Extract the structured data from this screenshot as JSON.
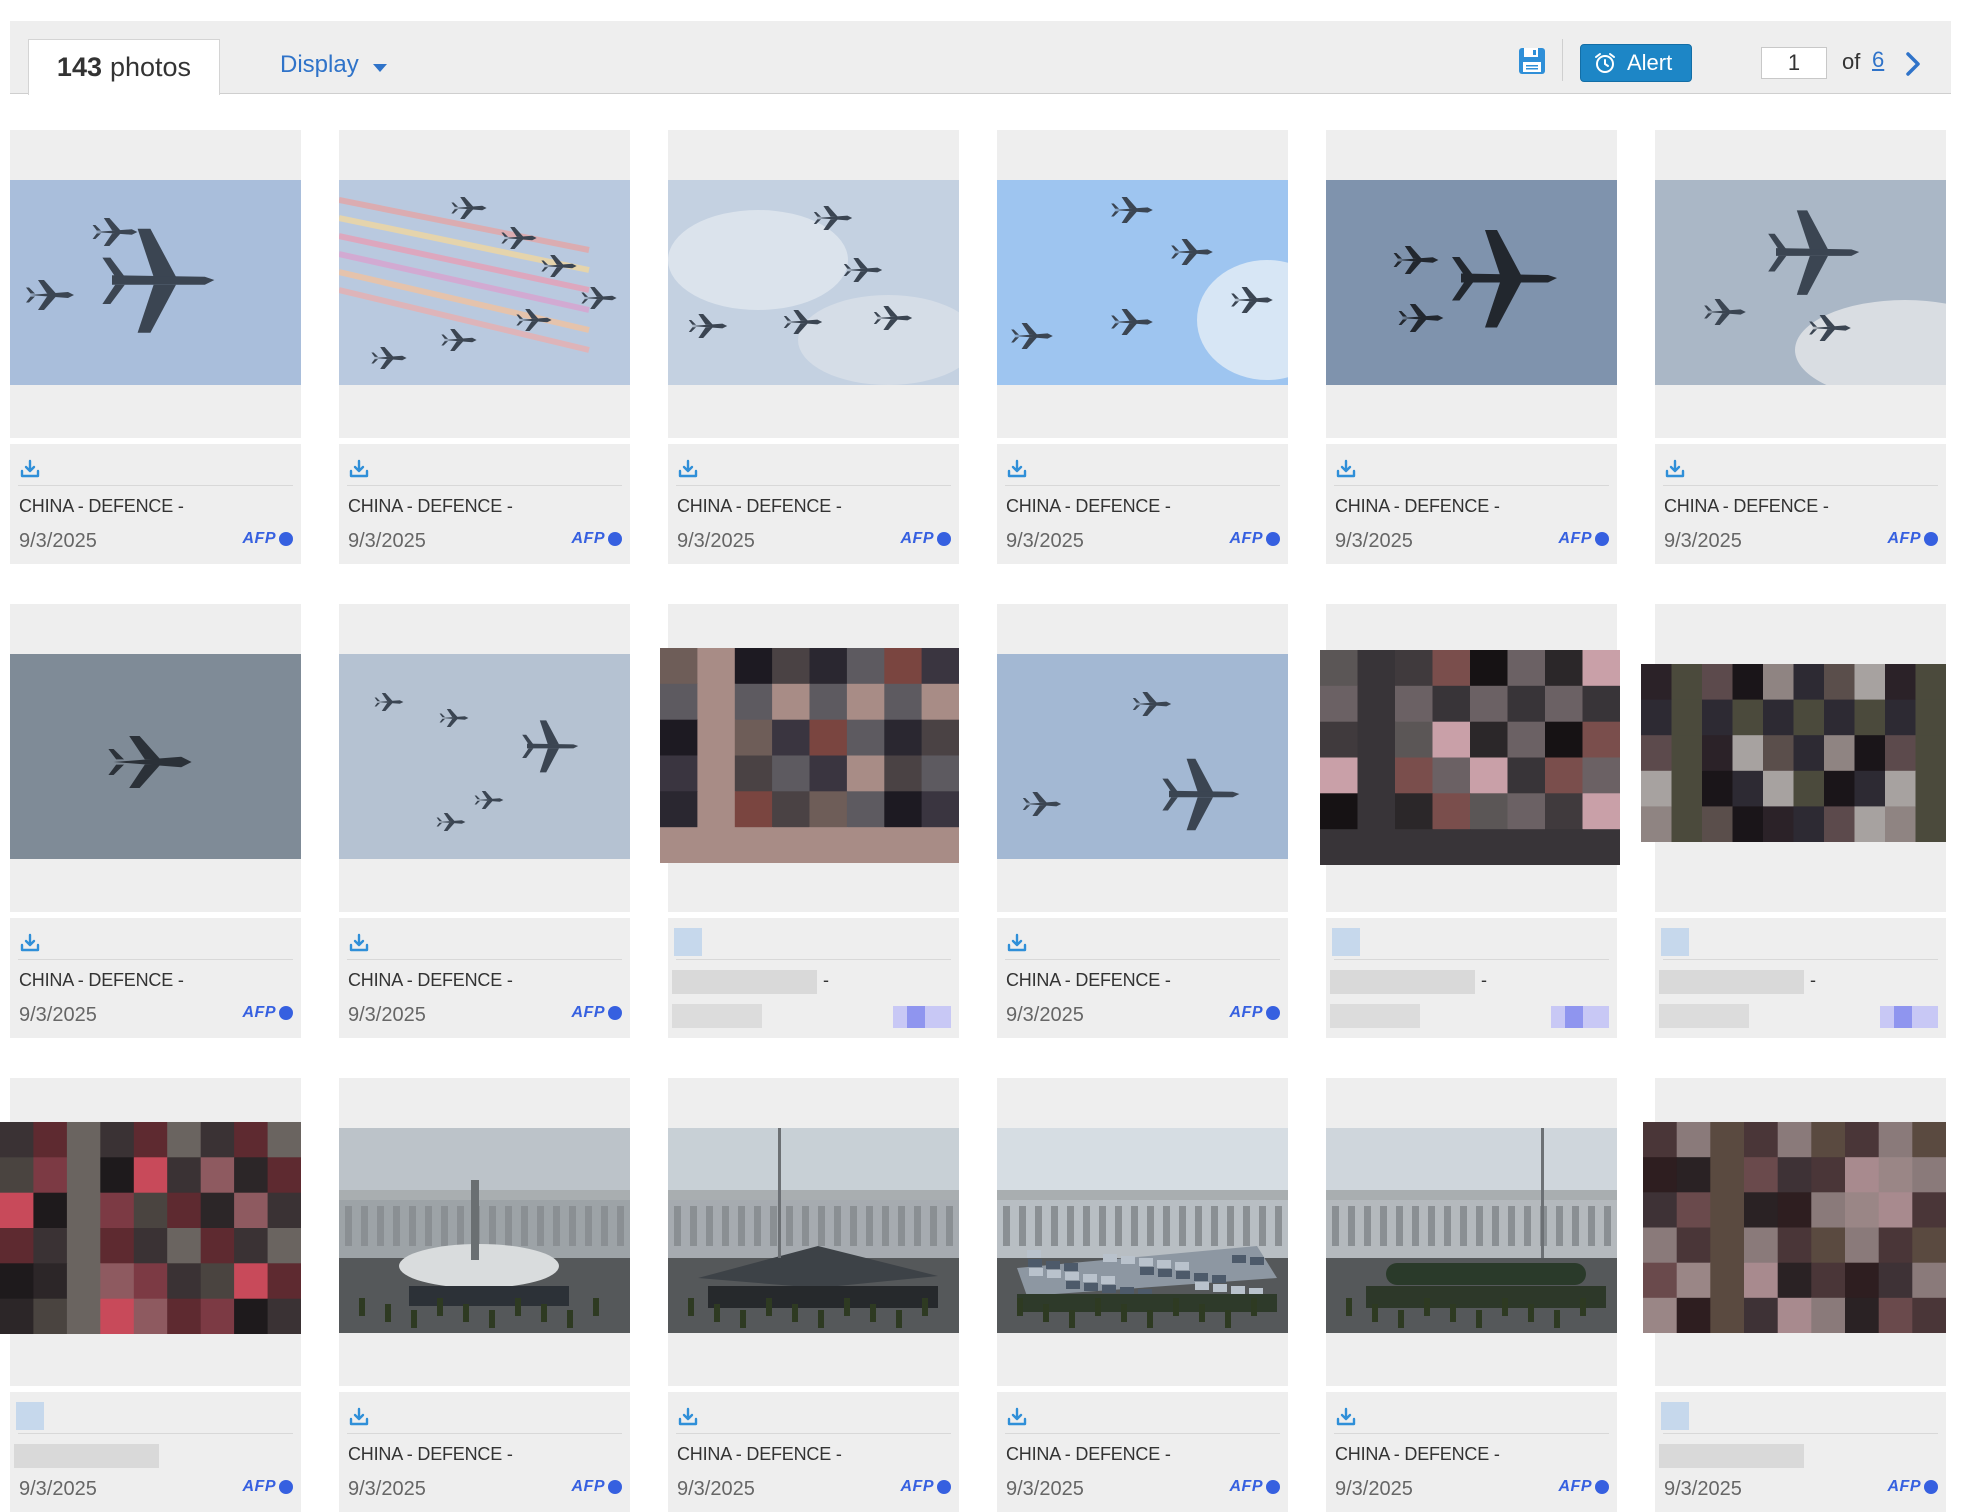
{
  "toolbar": {
    "count": "143",
    "count_label": "photos",
    "display_label": "Display",
    "save_icon": "floppy-disk-icon",
    "alert_icon": "alarm-clock-icon",
    "alert_label": "Alert",
    "page_value": "1",
    "of_label": "of",
    "total_pages": "6",
    "next_icon": "chevron-right-icon",
    "accent_color": "#2f73c9",
    "alert_color": "#1d86c6"
  },
  "photos": [
    {
      "caption": "CHINA - DEFENCE -",
      "date": "9/3/2025",
      "credit": "AFP",
      "visual": "aircraft formation in blue sky"
    },
    {
      "caption": "CHINA - DEFENCE -",
      "date": "9/3/2025",
      "credit": "AFP",
      "visual": "jets with colored smoke trails"
    },
    {
      "caption": "CHINA - DEFENCE -",
      "date": "9/3/2025",
      "credit": "AFP",
      "visual": "jets in cloudy sky"
    },
    {
      "caption": "CHINA - DEFENCE -",
      "date": "9/3/2025",
      "credit": "AFP",
      "visual": "jets in bright blue sky"
    },
    {
      "caption": "CHINA - DEFENCE -",
      "date": "9/3/2025",
      "credit": "AFP",
      "visual": "transport plane with escorts"
    },
    {
      "caption": "CHINA - DEFENCE -",
      "date": "9/3/2025",
      "credit": "AFP",
      "visual": "tanker aircraft refueling"
    },
    {
      "caption": "CHINA - DEFENCE -",
      "date": "9/3/2025",
      "credit": "AFP",
      "visual": "single fighter jet"
    },
    {
      "caption": "CHINA - DEFENCE -",
      "date": "9/3/2025",
      "credit": "AFP",
      "visual": "formation of five aircraft"
    },
    {
      "caption": "",
      "date": "",
      "credit": "",
      "visual": "pixelated image"
    },
    {
      "caption": "CHINA - DEFENCE -",
      "date": "9/3/2025",
      "credit": "AFP",
      "visual": "three aircraft"
    },
    {
      "caption": "",
      "date": "",
      "credit": "",
      "visual": "pixelated image"
    },
    {
      "caption": "",
      "date": "",
      "credit": "",
      "visual": "pixelated image"
    },
    {
      "caption": "",
      "date": "9/3/2025",
      "credit": "AFP",
      "visual": "pixelated image"
    },
    {
      "caption": "CHINA - DEFENCE -",
      "date": "9/3/2025",
      "credit": "AFP",
      "visual": "unmanned helicopter on parade vehicle"
    },
    {
      "caption": "CHINA - DEFENCE -",
      "date": "9/3/2025",
      "credit": "AFP",
      "visual": "stealth drone on parade vehicle"
    },
    {
      "caption": "CHINA - DEFENCE -",
      "date": "9/3/2025",
      "credit": "AFP",
      "visual": "camouflaged vessel on parade vehicle"
    },
    {
      "caption": "CHINA - DEFENCE -",
      "date": "9/3/2025",
      "credit": "AFP",
      "visual": "torpedo-shaped drone on parade vehicle"
    },
    {
      "caption": "",
      "date": "9/3/2025",
      "credit": "AFP",
      "visual": "pixelated image"
    }
  ]
}
